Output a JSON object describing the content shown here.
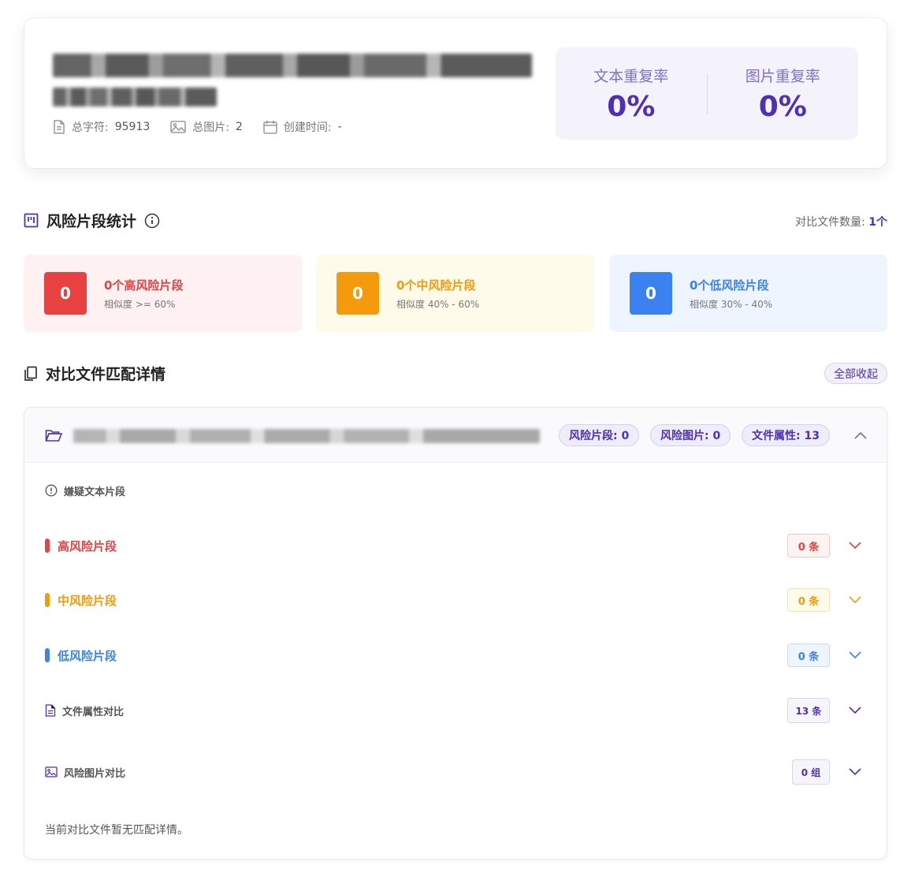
{
  "header": {
    "meta": {
      "chars_label": "总字符:",
      "chars_value": "95913",
      "images_label": "总图片:",
      "images_value": "2",
      "created_label": "创建时间:",
      "created_value": "-"
    },
    "rates": {
      "text_label": "文本重复率",
      "text_value": "0%",
      "image_label": "图片重复率",
      "image_value": "0%"
    }
  },
  "risk_section": {
    "title": "风险片段统计",
    "compare_label": "对比文件数量:",
    "compare_value": "1个",
    "cards": [
      {
        "count": "0",
        "title": "0个高风险片段",
        "range": "相似度 >= 60%",
        "color": "#e84141",
        "bg": "#fff1f1"
      },
      {
        "count": "0",
        "title": "0个中风险片段",
        "range": "相似度 40% - 60%",
        "color": "#f59a0c",
        "bg": "#fffbea"
      },
      {
        "count": "0",
        "title": "0个低风险片段",
        "range": "相似度 30% - 40%",
        "color": "#3b82f0",
        "bg": "#eef5ff"
      }
    ]
  },
  "detail_section": {
    "title": "对比文件匹配详情",
    "collapse_all": "全部收起",
    "file": {
      "pills": [
        "风险片段: 0",
        "风险图片: 0",
        "文件属性: 13"
      ]
    },
    "suspect_label": "嫌疑文本片段",
    "rows": [
      {
        "label": "高风险片段",
        "count": "0 条",
        "color": "#e84141",
        "bg": "#fff2f2",
        "border": "#f6c9c9"
      },
      {
        "label": "中风险片段",
        "count": "0 条",
        "color": "#f59a0c",
        "bg": "#fffbea",
        "border": "#f6e2b0"
      },
      {
        "label": "低风险片段",
        "count": "0 条",
        "color": "#3b82f0",
        "bg": "#eff5ff",
        "border": "#c8daf6"
      }
    ],
    "attr_row": {
      "label": "文件属性对比",
      "count": "13 条"
    },
    "image_row": {
      "label": "风险图片对比",
      "count": "0 组"
    },
    "empty_message": "当前对比文件暂无匹配详情。"
  }
}
